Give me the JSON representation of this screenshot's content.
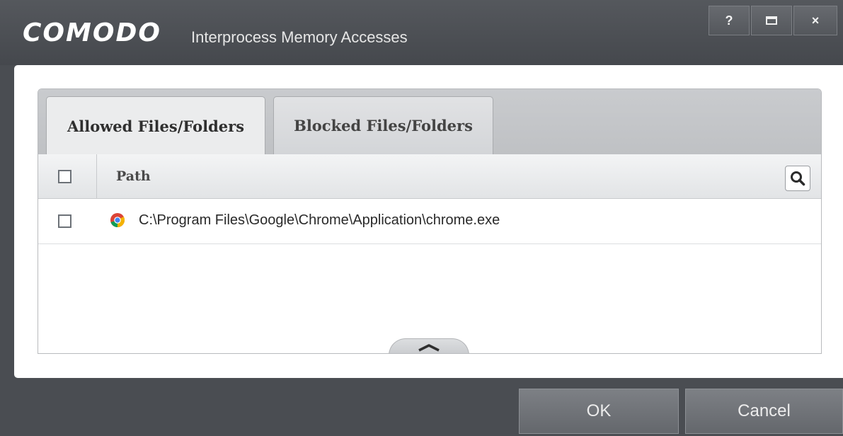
{
  "window": {
    "brand": "COMODO",
    "title": "Interprocess Memory Accesses",
    "help_label": "?",
    "close_label": "×"
  },
  "tabs": [
    {
      "label": "Allowed Files/Folders",
      "active": true
    },
    {
      "label": "Blocked Files/Folders",
      "active": false
    }
  ],
  "table": {
    "columns": [
      "Path"
    ],
    "rows": [
      {
        "checked": false,
        "icon": "chrome-icon",
        "path": "C:\\Program Files\\Google\\Chrome\\Application\\chrome.exe"
      }
    ],
    "header_checkbox_checked": false
  },
  "buttons": {
    "ok": "OK",
    "cancel": "Cancel"
  },
  "colors": {
    "frame": "#4a4d52",
    "content_bg": "#ffffff",
    "tabstrip": "#c4c6c9"
  }
}
